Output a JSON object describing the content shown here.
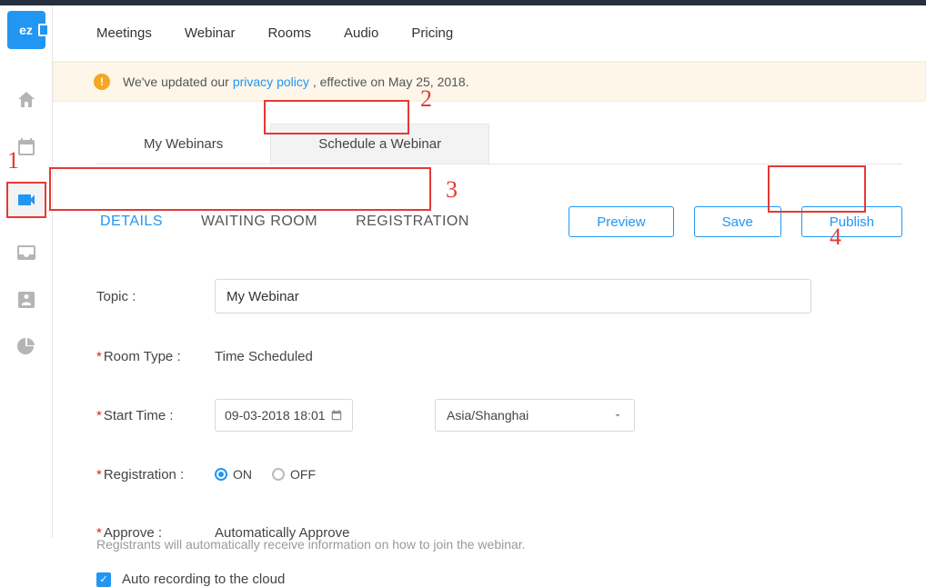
{
  "topnav": {
    "items": [
      "Meetings",
      "Webinar",
      "Rooms",
      "Audio",
      "Pricing"
    ]
  },
  "notice": {
    "prefix": "We've updated our ",
    "link_text": "privacy policy",
    "suffix": ", effective on May 25, 2018."
  },
  "tabs": {
    "my_webinars": "My Webinars",
    "schedule": "Schedule a Webinar"
  },
  "subtabs": {
    "details": "DETAILS",
    "waiting": "WAITING ROOM",
    "registration": "REGISTRATION"
  },
  "actions": {
    "preview": "Preview",
    "save": "Save",
    "publish": "Publish"
  },
  "form": {
    "topic_label": "Topic :",
    "topic_value": "My Webinar",
    "room_type_label": "Room Type :",
    "room_type_value": "Time Scheduled",
    "start_time_label": "Start Time :",
    "start_time_value": "09-03-2018 18:01",
    "timezone": "Asia/Shanghai",
    "registration_label": "Registration :",
    "reg_on": "ON",
    "reg_off": "OFF",
    "approve_label": "Approve :",
    "approve_value": "Automatically Approve",
    "helper": "Registrants will automatically receive information on how to join the webinar.",
    "auto_record": "Auto recording to the cloud"
  },
  "annotations": {
    "n1": "1",
    "n2": "2",
    "n3": "3",
    "n4": "4"
  },
  "logo_text": "ez"
}
